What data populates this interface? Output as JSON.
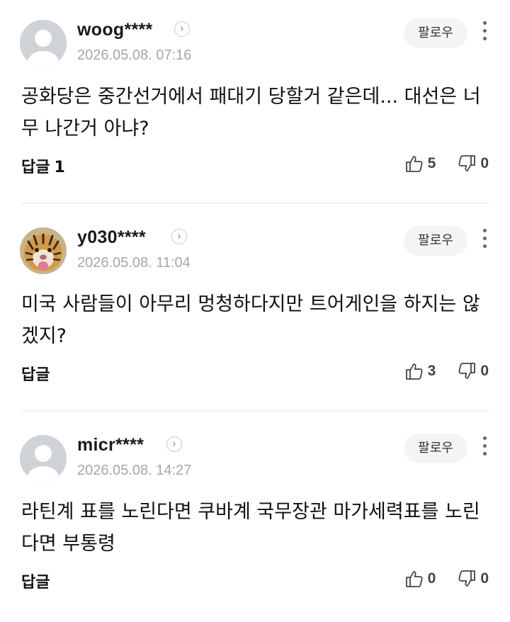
{
  "common": {
    "follow_label": "팔로우",
    "chevron_glyph": "›",
    "reply_label": "답글"
  },
  "comments": [
    {
      "username": "woog****",
      "date": "2026.05.08. 07:16",
      "avatar": "default-avatar",
      "content": "공화당은 중간선거에서 패대기 당할거 같은데... 대선은 너무 나간거 아냐?",
      "reply_count": "1",
      "likes": "5",
      "dislikes": "0"
    },
    {
      "username": "y030****",
      "date": "2026.05.08. 11:04",
      "avatar": "tiger-avatar",
      "content": "미국 사람들이 아무리 멍청하다지만 트어게인을 하지는 않겠지?",
      "reply_count": "",
      "likes": "3",
      "dislikes": "0"
    },
    {
      "username": "micr****",
      "date": "2026.05.08. 14:27",
      "avatar": "default-avatar",
      "content": "라틴계 표를 노린다면 쿠바계 국무장관 마가세력표를 노린다면 부통령",
      "reply_count": "",
      "likes": "0",
      "dislikes": "0"
    }
  ]
}
